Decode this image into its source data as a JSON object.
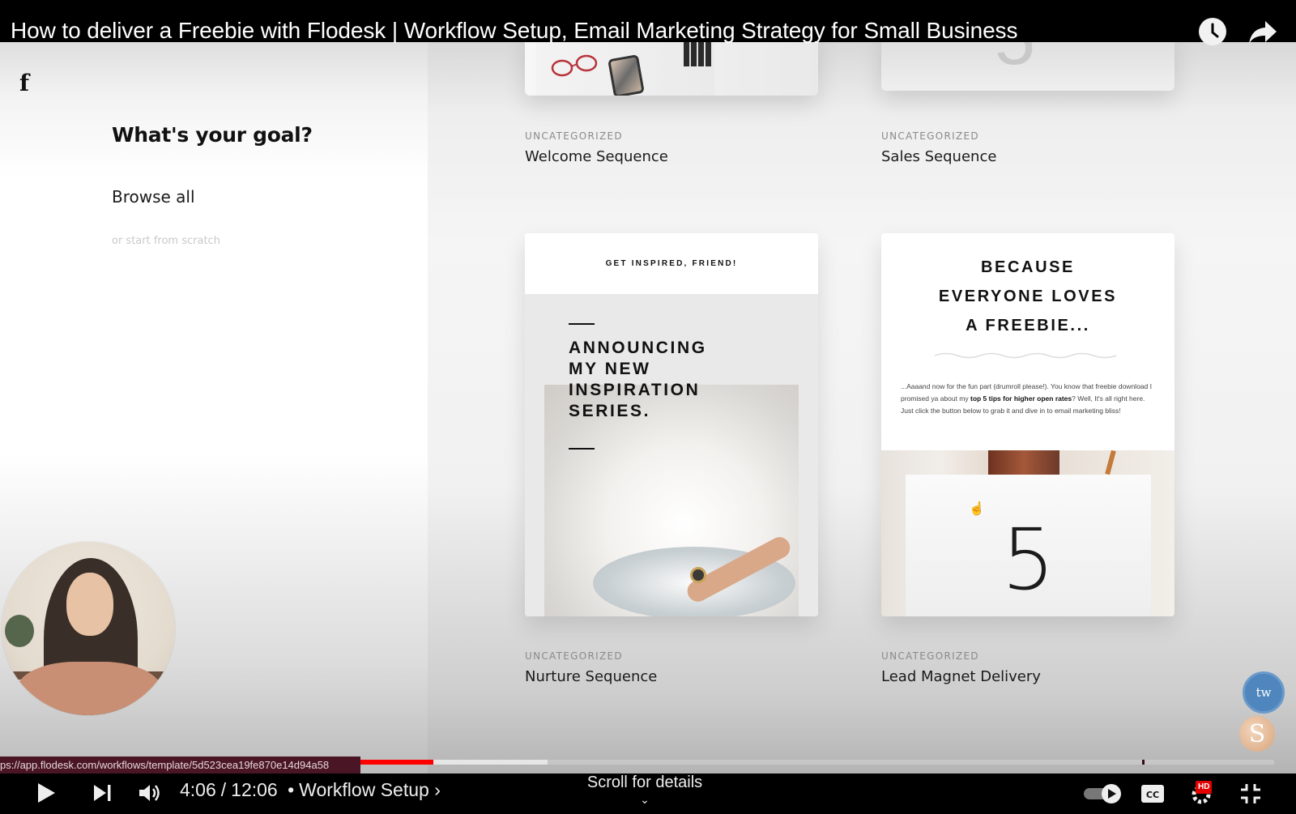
{
  "video": {
    "title": "How to deliver a Freebie with Flodesk | Workflow Setup, Email Marketing Strategy for Small Business",
    "current_time": "4:06",
    "duration": "12:06",
    "time_separator": "/",
    "chapter_bullet": "•",
    "chapter": "Workflow Setup",
    "chapter_chevron": "›",
    "progress_played_fraction": 0.34,
    "progress_buffered_fraction": 0.43,
    "scroll_hint": "Scroll for details",
    "scroll_chevron": "⌄",
    "hd_badge": "HD",
    "status_url": "ps://app.flodesk.com/workflows/template/5d523cea19fe870e14d94a58"
  },
  "icons": {
    "logo": "f",
    "cursor": "☝",
    "badge_tw": "tw",
    "badge_s": "S"
  },
  "sidebar": {
    "title": "What's your goal?",
    "browse_all": "Browse all",
    "scratch": "or start from scratch"
  },
  "templates": [
    {
      "category": "UNCATEGORIZED",
      "name": "Welcome Sequence"
    },
    {
      "category": "UNCATEGORIZED",
      "name": "Sales Sequence"
    },
    {
      "category": "UNCATEGORIZED",
      "name": "Nurture Sequence",
      "preview_header": "GET INSPIRED, FRIEND!",
      "preview_headline": [
        "ANNOUNCING",
        "MY NEW",
        "INSPIRATION",
        "SERIES."
      ]
    },
    {
      "category": "UNCATEGORIZED",
      "name": "Lead Magnet Delivery",
      "preview_title": [
        "BECAUSE",
        "EVERYONE LOVES",
        "A FREEBIE..."
      ],
      "preview_text_1": "...Aaaand now for the fun part (drumroll please!). You know that freebie download I promised ya about my ",
      "preview_text_bold": "top 5 tips for higher open rates",
      "preview_text_2": "? Well, It's all right here. Just click the button below to grab it and dive in to email marketing bliss!",
      "preview_number": "5"
    }
  ],
  "colors": {
    "progress_red": "#ff0000",
    "hd_red": "#e40000",
    "badge_blue": "#4f86bd"
  }
}
